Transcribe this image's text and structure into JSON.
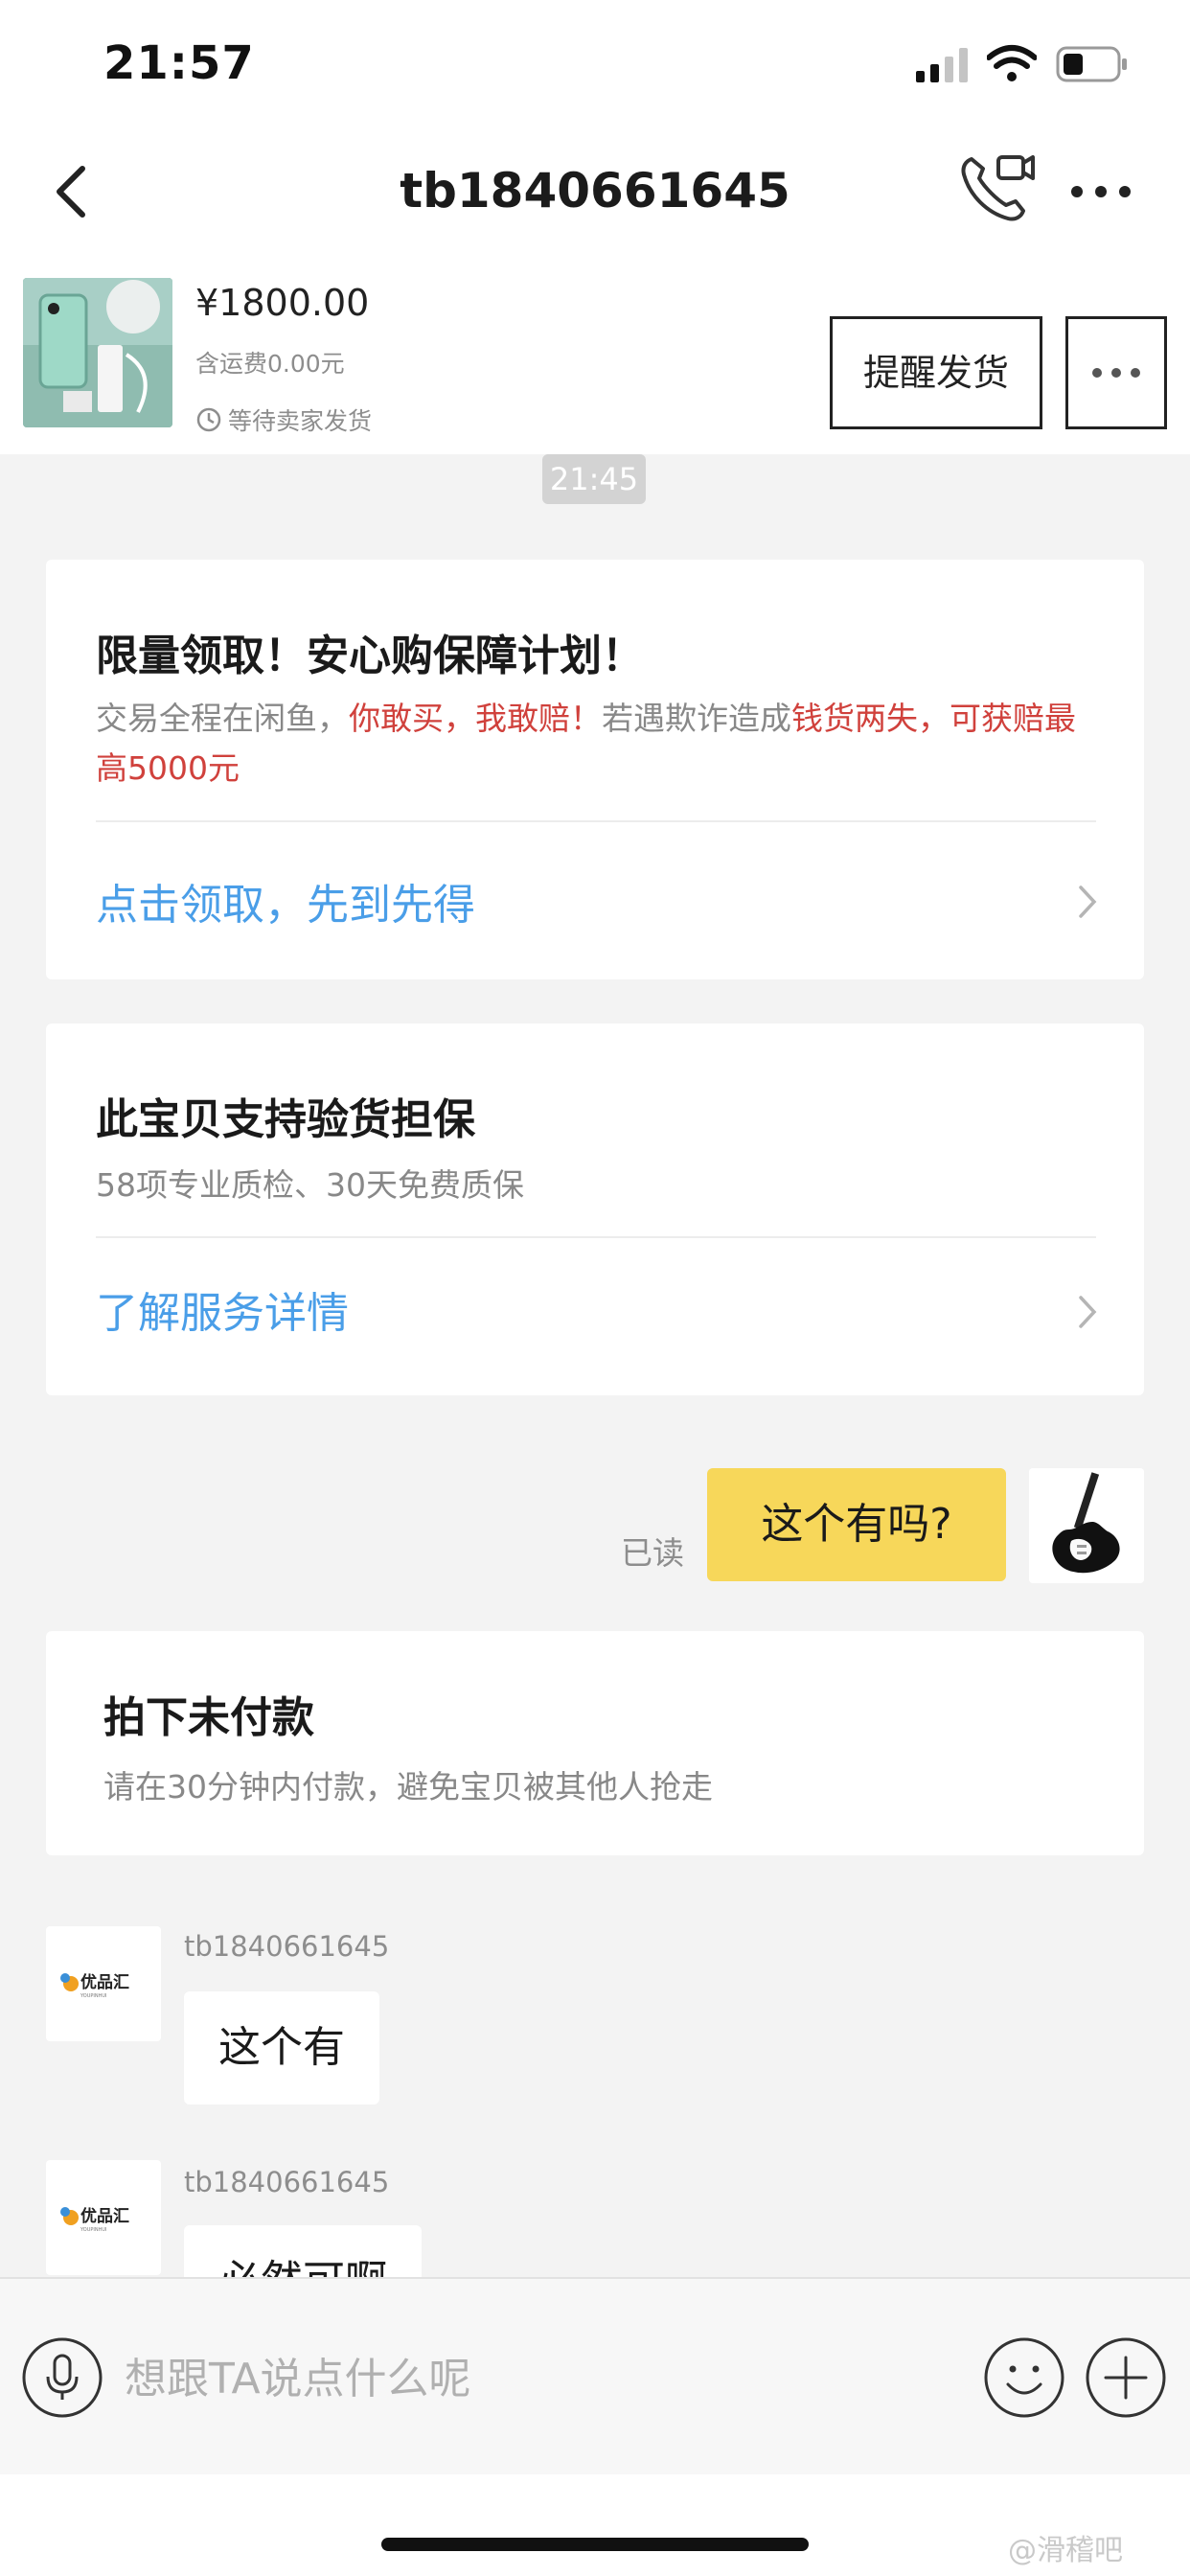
{
  "status_bar": {
    "time": "21:57"
  },
  "nav": {
    "title": "tb1840661645"
  },
  "item": {
    "price": "¥1800.00",
    "shipping": "含运费0.00元",
    "status": "等待卖家发货",
    "remind_button": "提醒发货"
  },
  "chat": {
    "timestamp": "21:45",
    "protection_card": {
      "title": "限量领取！安心购保障计划！",
      "desc_part1": "交易全程在闲鱼，",
      "desc_part2": "你敢买，我敢赔！",
      "desc_part3": "若遇欺诈造成",
      "desc_part4": "钱货两失，可获赔最高5000元",
      "link": "点击领取，先到先得"
    },
    "inspection_card": {
      "title": "此宝贝支持验货担保",
      "desc": "58项专业质检、30天免费质保",
      "link": "了解服务详情"
    },
    "my_message": {
      "text": "这个有吗?",
      "read_status": "已读"
    },
    "unpaid_card": {
      "title": "拍下未付款",
      "desc": "请在30分钟内付款，避免宝贝被其他人抢走"
    },
    "other_messages": [
      {
        "sender": "tb1840661645",
        "text": "这个有"
      },
      {
        "sender": "tb1840661645",
        "text": "必然可啊"
      }
    ],
    "seller_avatar_logo": "优品汇",
    "seller_avatar_logo_sub": "YOUPINHUI"
  },
  "input": {
    "placeholder": "想跟TA说点什么呢"
  },
  "watermark": "@滑稽吧",
  "colors": {
    "accent_yellow": "#f7d75a",
    "link_blue": "#4a9ee8",
    "warn_red": "#d0413c"
  },
  "icons": [
    "back-icon",
    "phone-video-icon",
    "more-icon",
    "clock-icon",
    "chevron-right-icon",
    "voice-icon",
    "emoji-icon",
    "plus-icon"
  ]
}
